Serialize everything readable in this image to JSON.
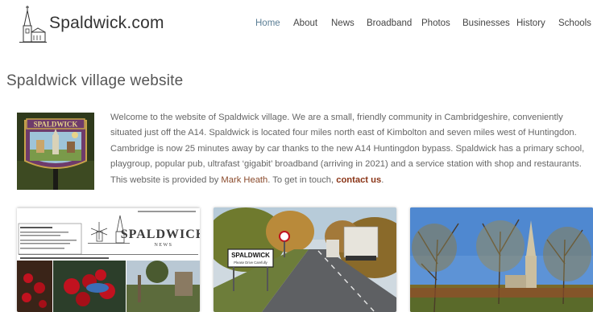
{
  "site": {
    "name": "Spaldwick.com"
  },
  "nav": {
    "items": [
      {
        "label": "Home",
        "active": true
      },
      {
        "label": "About"
      },
      {
        "label": "News"
      },
      {
        "label": "Broadband"
      },
      {
        "label": "Photos"
      },
      {
        "label": "Businesses"
      },
      {
        "label": "History"
      },
      {
        "label": "Schools"
      }
    ]
  },
  "page": {
    "title": "Spaldwick village website",
    "intro_text": "Welcome to the website of Spaldwick village. We are a small, friendly community in Cambridgeshire, conveniently situated just off the A14. Spaldwick is located four miles north east of Kimbolton and seven miles west of Huntingdon. Cambridge is now 25 minutes away by car thanks to the new A14 Huntingdon bypass. Spaldwick has a primary school, playgroup, popular pub, ultrafast ‘gigabit’ broadband (arriving in 2021) and a service station with shop and restaurants. This website is provided by ",
    "author_link": "Mark Heath",
    "middle_text": ". To get in touch, ",
    "contact_link": "contact us",
    "end_text": "."
  },
  "village_sign": {
    "text": "SPALDWICK"
  },
  "cards": {
    "newsletter": {
      "title": "SPALDWICK",
      "subtitle": "NEWS"
    },
    "road_sign": {
      "text": "SPALDWICK",
      "subtext": "Please Drive Carefully"
    }
  },
  "colors": {
    "nav_active": "#5b7e95",
    "link_author": "#8a4a2b",
    "link_contact": "#8a3416"
  }
}
